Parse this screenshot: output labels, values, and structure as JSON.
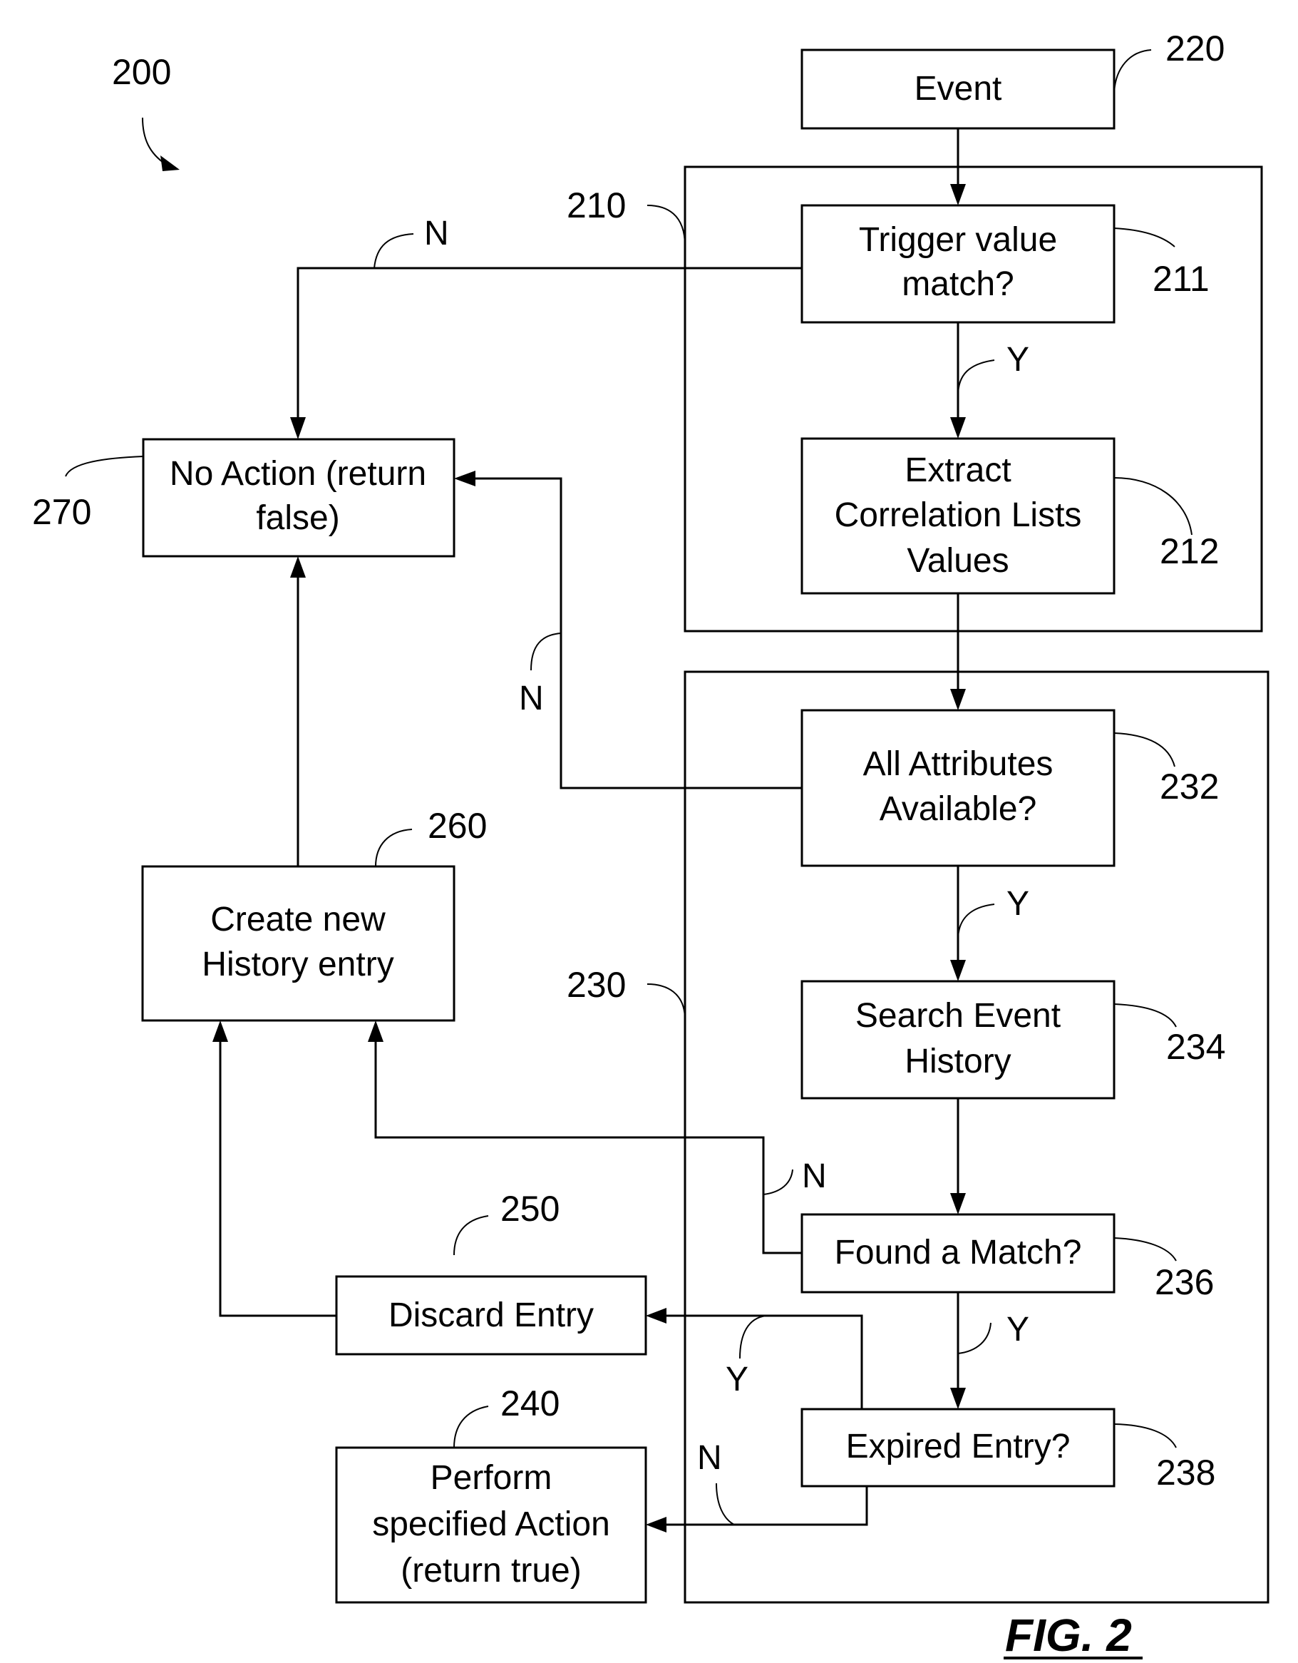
{
  "figure": {
    "number_label": "200",
    "caption": "FIG. 2"
  },
  "groups": {
    "g210": {
      "ref": "210"
    },
    "g230": {
      "ref": "230"
    }
  },
  "nodes": {
    "event": {
      "ref": "220",
      "lines": [
        "Event"
      ]
    },
    "trigger": {
      "ref": "211",
      "lines": [
        "Trigger value",
        "match?"
      ]
    },
    "extract": {
      "ref": "212",
      "lines": [
        "Extract",
        "Correlation Lists",
        "Values"
      ]
    },
    "attrs": {
      "ref": "232",
      "lines": [
        "All Attributes",
        "Available?"
      ]
    },
    "search": {
      "ref": "234",
      "lines": [
        "Search Event",
        "History"
      ]
    },
    "found": {
      "ref": "236",
      "lines": [
        "Found a Match?"
      ]
    },
    "expired": {
      "ref": "238",
      "lines": [
        "Expired Entry?"
      ]
    },
    "perform": {
      "ref": "240",
      "lines": [
        "Perform",
        "specified Action",
        "(return true)"
      ]
    },
    "discard": {
      "ref": "250",
      "lines": [
        "Discard Entry"
      ]
    },
    "create": {
      "ref": "260",
      "lines": [
        "Create new",
        "History entry"
      ]
    },
    "noaction": {
      "ref": "270",
      "lines": [
        "No Action (return",
        "false)"
      ]
    }
  },
  "edge_labels": {
    "trigger_no": "N",
    "trigger_yes": "Y",
    "attrs_no": "N",
    "attrs_yes": "Y",
    "found_no": "N",
    "found_yes": "Y",
    "expired_yes": "Y",
    "expired_no": "N"
  }
}
